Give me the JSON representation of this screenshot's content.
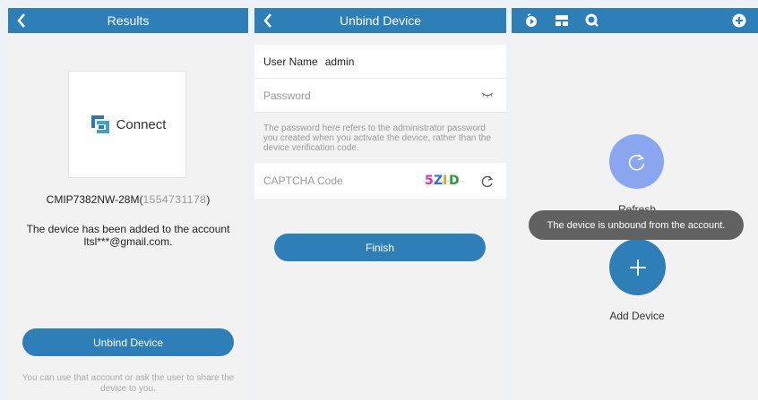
{
  "results_screen": {
    "title": "Results",
    "logo_text": "Connect",
    "model": "CMIP7382NW-28M(",
    "serial": "1554731178",
    "model_close": ")",
    "added_line1": "The device has been added to the account",
    "added_line2": "ltsl***@gmail.com.",
    "unbind_button": "Unbind Device",
    "hint": "You can use that account or ask the user to share the device to you."
  },
  "unbind_screen": {
    "title": "Unbind Device",
    "username_label": "User Name",
    "username_value": "admin",
    "password_placeholder": "Password",
    "note": "The password here refers to the administrator password you created when you activate the device, rather than the device verification code.",
    "captcha_label": "CAPTCHA Code",
    "captcha_chars": [
      "5",
      "Z",
      "I",
      "D"
    ],
    "captcha_colors": [
      "#d63aa0",
      "#2f6fd1",
      "#e0a020",
      "#2f9a3a"
    ],
    "finish_button": "Finish"
  },
  "device_screen": {
    "refresh_label": "Refresh",
    "add_label": "Add Device",
    "toast": "The device is unbound from the account."
  },
  "colors": {
    "brand_blue": "#2e7eb8",
    "refresh_purple": "#8aa6f0",
    "toast_gray": "#616161"
  }
}
